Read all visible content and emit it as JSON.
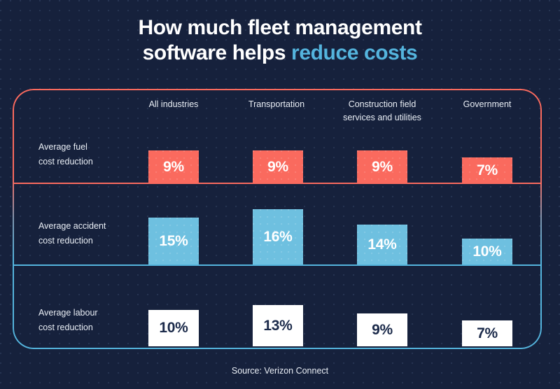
{
  "title": {
    "line1": "How much fleet management",
    "line2_plain": "software helps ",
    "line2_accent": "reduce costs"
  },
  "source": "Source: Verizon Connect",
  "colors": {
    "background": "#16213c",
    "coral": "#fa6a5e",
    "blue": "#54b4dd",
    "bar_blue": "#6ec0e0",
    "white": "#ffffff",
    "text": "#e9eef5",
    "dark_text": "#1b2a4a"
  },
  "chart_data": {
    "type": "bar",
    "title": "How much fleet management software helps reduce costs",
    "subtitle": "",
    "xlabel": "",
    "ylabel": "",
    "grid": false,
    "legend_position": "none",
    "source": "Source: Verizon Connect",
    "categories": [
      "All industries",
      "Transportation",
      "Construction field services and utilities",
      "Government"
    ],
    "category_labels": [
      {
        "line1": "All industries",
        "line2": ""
      },
      {
        "line1": "Transportation",
        "line2": ""
      },
      {
        "line1": "Construction field",
        "line2": "services and utilities"
      },
      {
        "line1": "Government",
        "line2": ""
      }
    ],
    "series": [
      {
        "name": "Average fuel cost reduction",
        "label_line1": "Average fuel",
        "label_line2": "cost reduction",
        "color": "#fa6a5e",
        "values": [
          9,
          9,
          9,
          7
        ],
        "value_labels": [
          "9%",
          "9%",
          "9%",
          "7%"
        ]
      },
      {
        "name": "Average accident cost reduction",
        "label_line1": "Average accident",
        "label_line2": "cost reduction",
        "color": "#6ec0e0",
        "values": [
          15,
          16,
          14,
          10
        ],
        "value_labels": [
          "15%",
          "16%",
          "14%",
          "10%"
        ]
      },
      {
        "name": "Average labour cost reduction",
        "label_line1": "Average labour",
        "label_line2": "cost reduction",
        "color": "#ffffff",
        "values": [
          10,
          13,
          9,
          7
        ],
        "value_labels": [
          "10%",
          "13%",
          "9%",
          "7%"
        ]
      }
    ],
    "units": "percent"
  }
}
